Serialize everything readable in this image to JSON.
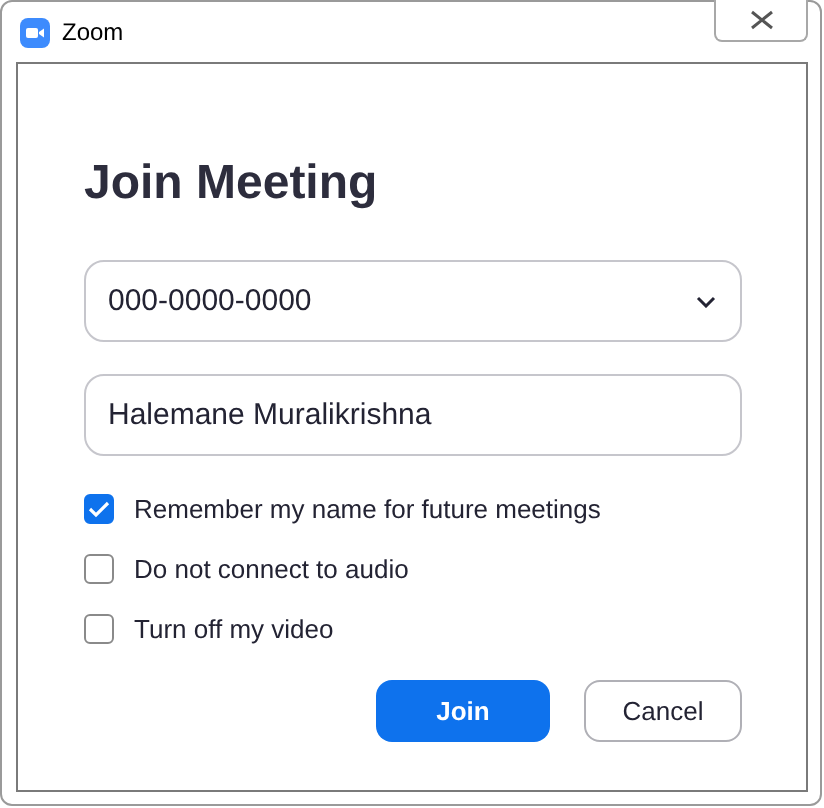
{
  "window": {
    "title": "Zoom"
  },
  "heading": "Join Meeting",
  "meeting_id": {
    "value": "000-0000-0000"
  },
  "name_field": {
    "value": "Halemane Muralikrishna"
  },
  "options": [
    {
      "label": "Remember my name for future meetings",
      "checked": true
    },
    {
      "label": "Do not connect to audio",
      "checked": false
    },
    {
      "label": "Turn off my video",
      "checked": false
    }
  ],
  "buttons": [
    {
      "label": "Join",
      "kind": "primary"
    },
    {
      "label": "Cancel",
      "kind": "secondary"
    }
  ]
}
